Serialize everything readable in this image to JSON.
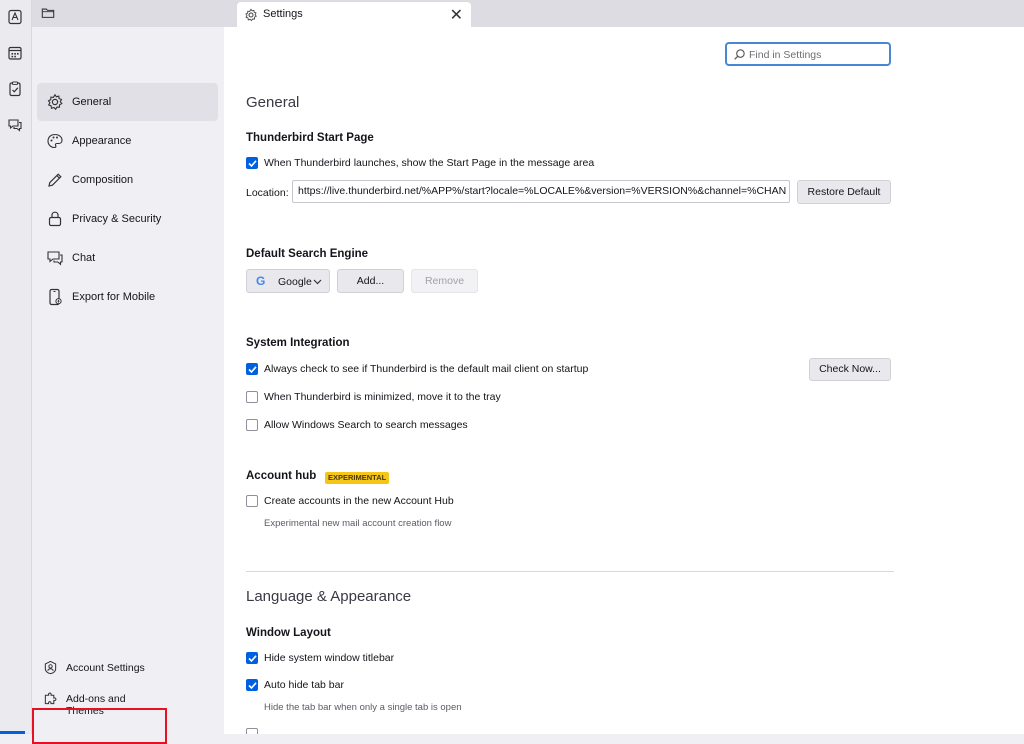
{
  "spaces": [
    "address-book-icon",
    "calendar-icon",
    "tasks-icon",
    "chat-icon"
  ],
  "tab": {
    "title": "Settings",
    "close": "✕"
  },
  "nav": {
    "items": [
      {
        "label": "General",
        "icon": "gear-icon",
        "selected": true
      },
      {
        "label": "Appearance",
        "icon": "palette-icon"
      },
      {
        "label": "Composition",
        "icon": "pencil-icon"
      },
      {
        "label": "Privacy & Security",
        "icon": "lock-icon"
      },
      {
        "label": "Chat",
        "icon": "chat-icon"
      },
      {
        "label": "Export for Mobile",
        "icon": "phone-icon"
      }
    ],
    "footer": [
      {
        "label": "Account Settings",
        "icon": "account-icon"
      },
      {
        "label": "Add-ons and Themes",
        "icon": "puzzle-icon",
        "highlighted": true
      }
    ]
  },
  "search": {
    "placeholder": "Find in Settings"
  },
  "general": {
    "heading": "General",
    "start_page": {
      "title": "Thunderbird Start Page",
      "checkbox": "When Thunderbird launches, show the Start Page in the message area",
      "checked": true,
      "location_label": "Location:",
      "location_value": "https://live.thunderbird.net/%APP%/start?locale=%LOCALE%&version=%VERSION%&channel=%CHAN",
      "restore_button": "Restore Default"
    },
    "search_engine": {
      "title": "Default Search Engine",
      "engine": "Google",
      "add_button": "Add...",
      "remove_button": "Remove"
    },
    "system_integration": {
      "title": "System Integration",
      "options": [
        {
          "label": "Always check to see if Thunderbird is the default mail client on startup",
          "checked": true
        },
        {
          "label": "When Thunderbird is minimized, move it to the tray",
          "checked": false
        },
        {
          "label": "Allow Windows Search to search messages",
          "checked": false
        }
      ],
      "check_now_button": "Check Now..."
    },
    "account_hub": {
      "title": "Account hub",
      "badge": "EXPERIMENTAL",
      "checkbox": "Create accounts in the new Account Hub",
      "checked": false,
      "description": "Experimental new mail account creation flow"
    }
  },
  "language_appearance": {
    "heading": "Language & Appearance",
    "window_layout": {
      "title": "Window Layout",
      "options": [
        {
          "label": "Hide system window titlebar",
          "checked": true
        },
        {
          "label": "Auto hide tab bar",
          "checked": true,
          "description": "Hide the tab bar when only a single tab is open"
        }
      ]
    }
  },
  "colors": {
    "accent": "#0061e0",
    "highlight": "#e81123",
    "badge": "#f5c518"
  }
}
